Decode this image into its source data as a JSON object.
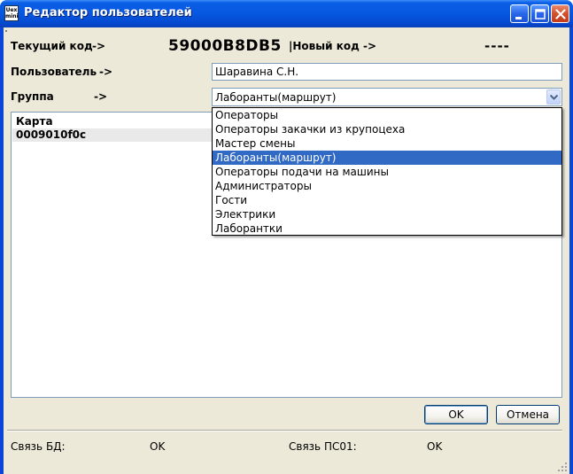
{
  "window": {
    "title": "Редактор пользователей",
    "app_icon_text": "Uex\nmini"
  },
  "form": {
    "current_code_label": "Текущий код",
    "current_code_arrow": "->",
    "current_code_value": "59000B8DB5",
    "new_code_label": "|Новый код",
    "new_code_arrow": "->",
    "new_code_value": "----",
    "user_label": "Пользователь",
    "user_arrow": "->",
    "user_value": "Шаравина С.Н.",
    "group_label": "Группа",
    "group_arrow": "->",
    "group_value": "Лаборанты(маршрут)"
  },
  "dropdown": {
    "options": [
      "Операторы",
      "Операторы закачки из крупоцеха",
      "Мастер смены",
      "Лаборанты(маршрут)",
      "Операторы подачи на машины",
      "Администраторы",
      "Гости",
      "Электрики",
      "Лаборантки"
    ],
    "selected_index": 3
  },
  "cards": {
    "header": "Карта",
    "rows": [
      "0009010f0c"
    ]
  },
  "buttons": {
    "ok": "OK",
    "cancel": "Отмена"
  },
  "status": {
    "db_label": "Связь БД:",
    "db_value": "OK",
    "pc_label": "Связь ПС01:",
    "pc_value": "OK"
  },
  "colors": {
    "titlebar": "#0757e0",
    "selection": "#316ac5",
    "face": "#ece9d8"
  }
}
